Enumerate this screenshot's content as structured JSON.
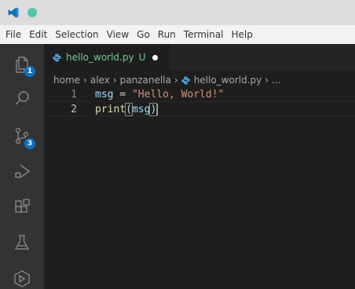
{
  "menu": {
    "items": [
      "File",
      "Edit",
      "Selection",
      "View",
      "Go",
      "Run",
      "Terminal",
      "Help"
    ]
  },
  "activity": {
    "explorer_badge": "1",
    "scm_badge": "3",
    "icons": [
      "files-icon",
      "search-icon",
      "source-control-icon",
      "run-debug-icon",
      "extensions-icon",
      "testing-icon",
      "remote-icon"
    ]
  },
  "tab": {
    "filename": "hello_world.py",
    "status": "U"
  },
  "breadcrumb": {
    "parts": [
      "home",
      "alex",
      "panzanella",
      "hello_world.py",
      "..."
    ]
  },
  "editor": {
    "lines": [
      {
        "number": "1",
        "tokens": {
          "var": "msg",
          "op": " = ",
          "str": "\"Hello, World!\""
        }
      },
      {
        "number": "2",
        "tokens": {
          "fn": "print",
          "open": "(",
          "arg": "msg",
          "close": ")"
        }
      }
    ]
  },
  "colors": {
    "accent": "#0e70c0",
    "untracked": "#73c991",
    "editor_bg": "#1e1e1e",
    "activity_bg": "#333333"
  }
}
